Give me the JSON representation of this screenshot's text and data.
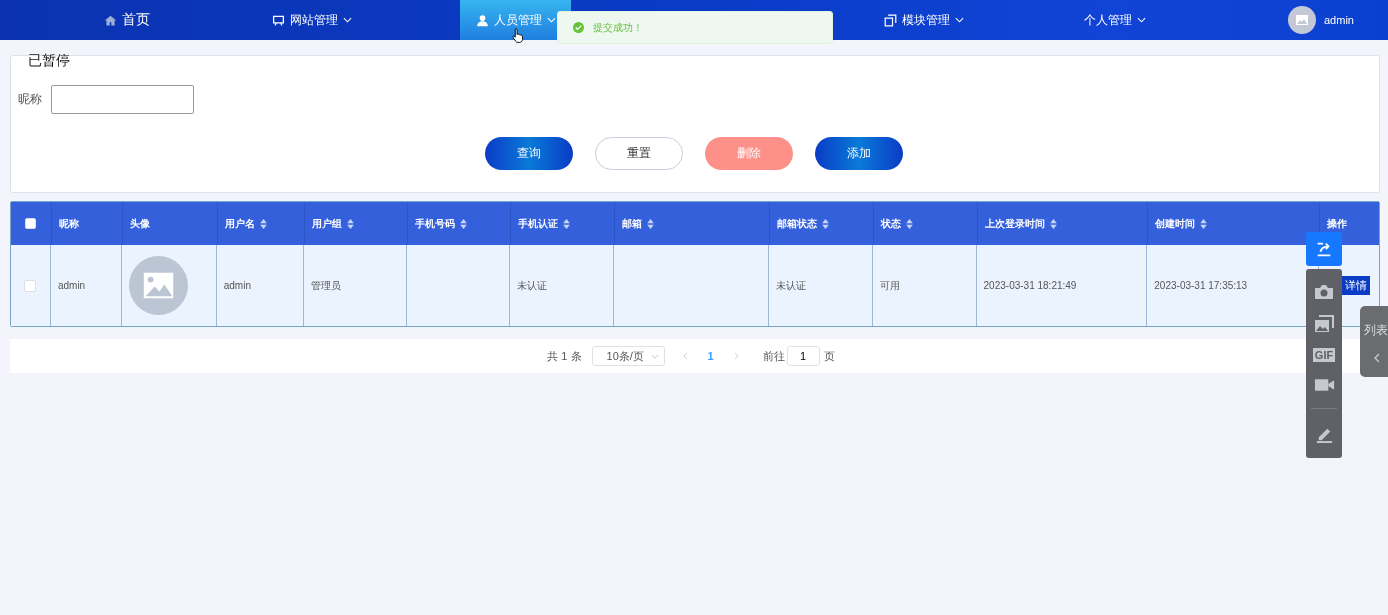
{
  "nav": {
    "items": [
      {
        "label": "首页",
        "dropdown": false,
        "selected": false
      },
      {
        "label": "网站管理",
        "dropdown": true,
        "selected": false
      },
      {
        "label": "人员管理",
        "dropdown": true,
        "selected": true
      },
      {
        "label": "模块管理",
        "dropdown": true,
        "selected": false
      },
      {
        "label": "个人管理",
        "dropdown": true,
        "selected": false
      }
    ],
    "user": {
      "name": "admin"
    }
  },
  "toast": {
    "message": "提交成功！"
  },
  "recorder_status": "已暂停",
  "search": {
    "fields": [
      {
        "label": "昵称"
      }
    ],
    "buttons": [
      {
        "label": "查询",
        "kind": "primary"
      },
      {
        "label": "重置",
        "kind": "plain"
      },
      {
        "label": "删除",
        "kind": "danger"
      },
      {
        "label": "添加",
        "kind": "primary"
      }
    ]
  },
  "table": {
    "select_all_checked": false,
    "columns": [
      {
        "label": "昵称",
        "sortable": false
      },
      {
        "label": "头像",
        "sortable": false
      },
      {
        "label": "用户名",
        "sortable": true
      },
      {
        "label": "用户组",
        "sortable": true
      },
      {
        "label": "手机号码",
        "sortable": true
      },
      {
        "label": "手机认证",
        "sortable": true
      },
      {
        "label": "邮箱",
        "sortable": true
      },
      {
        "label": "邮箱状态",
        "sortable": true
      },
      {
        "label": "状态",
        "sortable": true
      },
      {
        "label": "上次登录时间",
        "sortable": true
      },
      {
        "label": "创建时间",
        "sortable": true
      },
      {
        "label": "操作",
        "sortable": false
      }
    ],
    "rows": [
      {
        "checked": false,
        "cells": [
          {
            "kind": "text",
            "text": "admin"
          },
          {
            "kind": "avatar"
          },
          {
            "kind": "text",
            "text": "admin"
          },
          {
            "kind": "text",
            "text": "管理员"
          },
          {
            "kind": "empty"
          },
          {
            "kind": "text",
            "text": "未认证"
          },
          {
            "kind": "empty"
          },
          {
            "kind": "text",
            "text": "未认证"
          },
          {
            "kind": "text",
            "text": "可用"
          },
          {
            "kind": "text",
            "text": "2023-03-31 18:21:49"
          },
          {
            "kind": "text",
            "text": "2023-03-31 17:35:13"
          },
          {
            "kind": "action",
            "text": "详情"
          }
        ]
      }
    ]
  },
  "pagination": {
    "total": "共 1 条",
    "page_size": "10条/页",
    "pages": [
      {
        "label": "1",
        "selected": true
      }
    ],
    "goto_label": "前往",
    "goto_value": "1",
    "goto_suffix": "页"
  },
  "recorder": {
    "tools": [
      {
        "kind": "camera"
      },
      {
        "kind": "images"
      },
      {
        "kind": "gif",
        "text": "GIF"
      },
      {
        "kind": "video"
      },
      {
        "kind": "pen"
      }
    ],
    "side_tab": {
      "label": "列表"
    }
  }
}
